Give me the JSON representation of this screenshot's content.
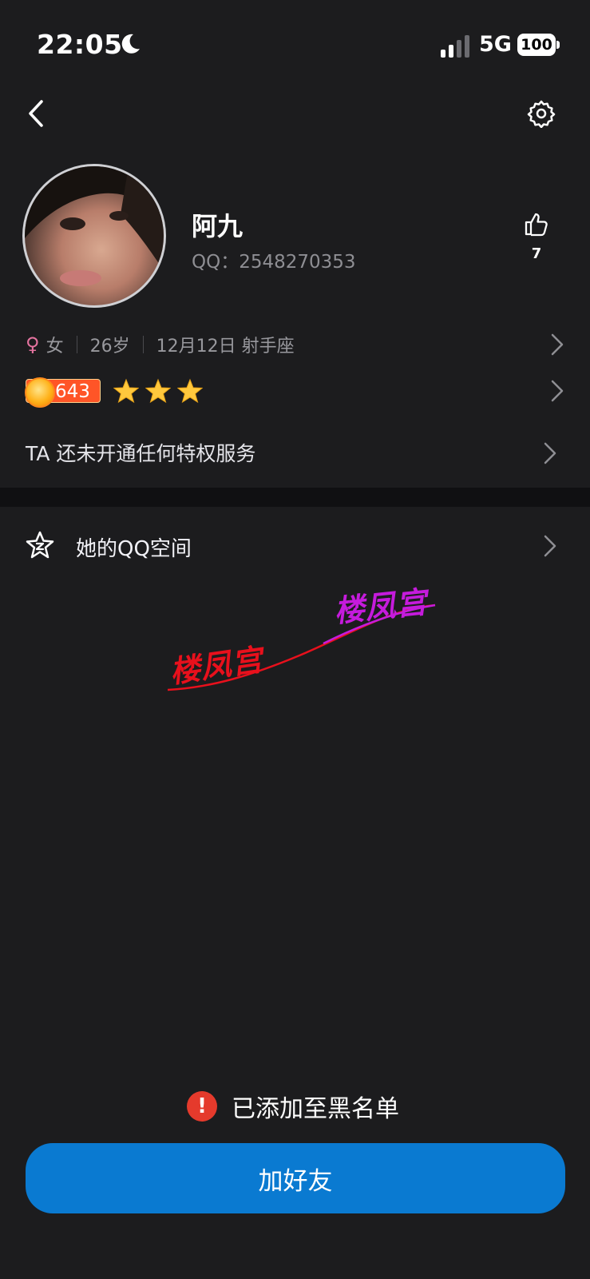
{
  "status_bar": {
    "time": "22:05",
    "network": "5G",
    "battery": "100"
  },
  "profile": {
    "name": "阿九",
    "qq": "QQ：2548270353",
    "likes": "7",
    "gender_symbol": "♀",
    "gender": "女",
    "age": "26岁",
    "birthday": "12月12日 射手座",
    "level": "643",
    "stars": 3
  },
  "privilege_text": "TA 还未开通任何特权服务",
  "qzone_label": "她的QQ空间",
  "watermark": {
    "text1": "楼凤宫",
    "text2": "楼凤宫"
  },
  "blacklist_notice": "已添加至黑名单",
  "add_friend_label": "加好友",
  "colors": {
    "accent": "#0a7ad1",
    "warning": "#e53a2c",
    "female": "#e4739f",
    "background": "#1c1c1e"
  }
}
